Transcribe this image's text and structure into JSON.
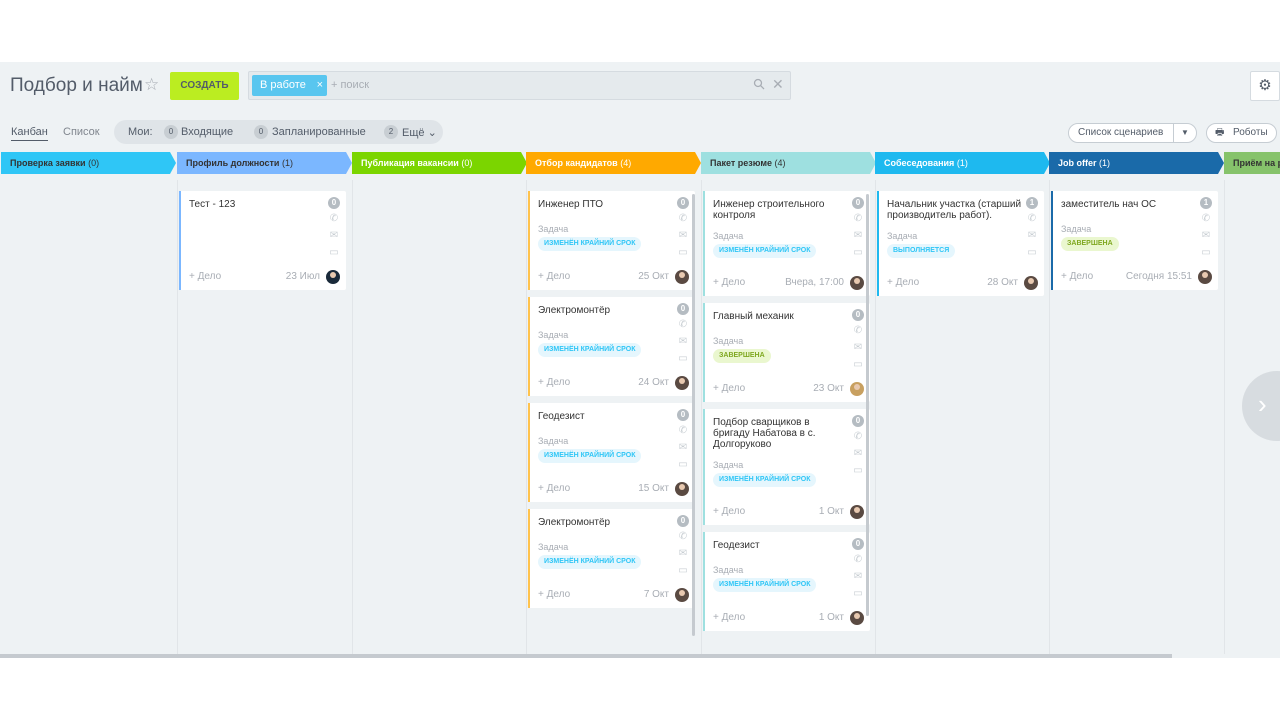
{
  "header": {
    "title": "Подбор и найм",
    "create_label": "СОЗДАТЬ",
    "filter_chip": "В работе",
    "search_placeholder": "+ поиск"
  },
  "toolbar": {
    "view_kanban": "Канбан",
    "view_list": "Список",
    "my_label": "Мои:",
    "incoming_count": "0",
    "incoming_label": "Входящие",
    "planned_count": "0",
    "planned_label": "Запланированные",
    "more_count": "2",
    "more_label": "Ещё",
    "scenarios_label": "Список сценариев",
    "robots_label": "Роботы"
  },
  "colors": {
    "accent_green": "#bbed21",
    "chip_blue": "#59c6ef",
    "stage_colors": [
      "#2fc6f6",
      "#7bb7ff",
      "#7bd500",
      "#ffa900",
      "#9dcfeb",
      "#1eb9ef",
      "#1a6aa9",
      "#86c36b"
    ]
  },
  "columns": [
    {
      "title": "Проверка заявки",
      "count": "(0)"
    },
    {
      "title": "Профиль должности",
      "count": "(1)"
    },
    {
      "title": "Публикация вакансии",
      "count": "(0)"
    },
    {
      "title": "Отбор кандидатов",
      "count": "(4)"
    },
    {
      "title": "Пакет резюме",
      "count": "(4)"
    },
    {
      "title": "Собеседования",
      "count": "(1)"
    },
    {
      "title": "Job offer",
      "count": "(1)"
    },
    {
      "title": "Приём на р",
      "count": ""
    }
  ],
  "cards": {
    "profile": [
      {
        "title": "Тест - 123",
        "badge": "0",
        "add": "+ Дело",
        "date": "23 Июл"
      }
    ],
    "selection": [
      {
        "title": "Инженер ПТО",
        "badge": "0",
        "type": "Задача",
        "tag": "ИЗМЕНЁН КРАЙНИЙ СРОК",
        "add": "+ Дело",
        "date": "25 Окт"
      },
      {
        "title": "Электромонтёр",
        "badge": "0",
        "type": "Задача",
        "tag": "ИЗМЕНЁН КРАЙНИЙ СРОК",
        "add": "+ Дело",
        "date": "24 Окт"
      },
      {
        "title": "Геодезист",
        "badge": "0",
        "type": "Задача",
        "tag": "ИЗМЕНЁН КРАЙНИЙ СРОК",
        "add": "+ Дело",
        "date": "15 Окт"
      },
      {
        "title": "Электромонтёр",
        "badge": "0",
        "type": "Задача",
        "tag": "ИЗМЕНЁН КРАЙНИЙ СРОК",
        "add": "+ Дело",
        "date": "7 Окт"
      }
    ],
    "resume": [
      {
        "title": "Инженер строительного контроля",
        "badge": "0",
        "type": "Задача",
        "tag": "ИЗМЕНЁН КРАЙНИЙ СРОК",
        "add": "+ Дело",
        "date": "Вчера, 17:00"
      },
      {
        "title": "Главный механик",
        "badge": "0",
        "type": "Задача",
        "tag": "ЗАВЕРШЕНА",
        "add": "+ Дело",
        "date": "23 Окт"
      },
      {
        "title": "Подбор сварщиков в бригаду Набатова в с. Долгоруково",
        "badge": "0",
        "type": "Задача",
        "tag": "ИЗМЕНЁН КРАЙНИЙ СРОК",
        "add": "+ Дело",
        "date": "1 Окт"
      },
      {
        "title": "Геодезист",
        "badge": "0",
        "type": "Задача",
        "tag": "ИЗМЕНЁН КРАЙНИЙ СРОК",
        "add": "+ Дело",
        "date": "1 Окт"
      }
    ],
    "interview": [
      {
        "title": "Начальник участка (старший производитель работ).",
        "badge": "1",
        "type": "Задача",
        "tag": "ВЫПОЛНЯЕТСЯ",
        "add": "+ Дело",
        "date": "28 Окт"
      }
    ],
    "offer": [
      {
        "title": "заместитель нач ОС",
        "badge": "1",
        "type": "Задача",
        "tag": "ЗАВЕРШЕНА",
        "add": "+ Дело",
        "date": "Сегодня 15:51"
      }
    ]
  }
}
